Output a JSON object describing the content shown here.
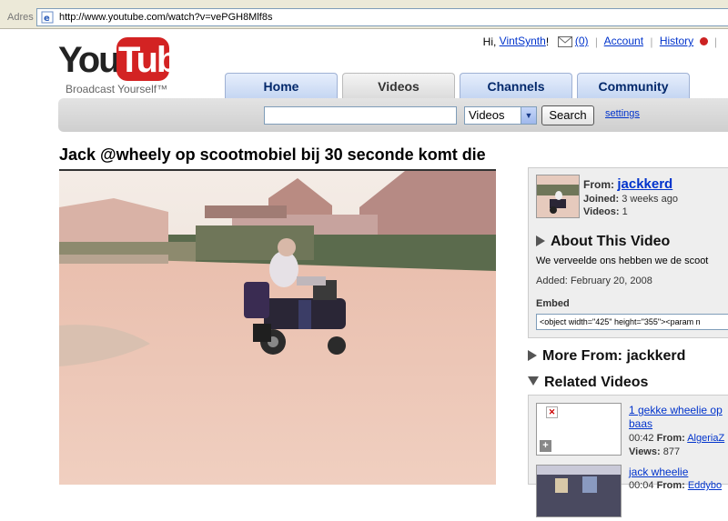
{
  "browser": {
    "address_label": "Adres",
    "url": "http://www.youtube.com/watch?v=vePGH8Mlf8s"
  },
  "header": {
    "logo_you": "You",
    "logo_tube": "Tube",
    "tagline": "Broadcast Yourself™",
    "greeting": "Hi,",
    "username": "VintSynth",
    "greeting_end": "!",
    "inbox_count": "(0)",
    "account_link": "Account",
    "history_link": "History"
  },
  "tabs": [
    {
      "label": "Home",
      "active": false
    },
    {
      "label": "Videos",
      "active": true
    },
    {
      "label": "Channels",
      "active": false
    },
    {
      "label": "Community",
      "active": false
    }
  ],
  "search": {
    "query": "",
    "category": "Videos",
    "button": "Search",
    "settings": "settings"
  },
  "video": {
    "title": "Jack @wheely op scootmobiel bij 30 seconde komt die"
  },
  "uploader": {
    "from_label": "From:",
    "name": "jackkerd",
    "joined_label": "Joined:",
    "joined": "3 weeks ago",
    "videos_label": "Videos:",
    "videos": "1"
  },
  "about": {
    "heading": "About This Video",
    "description": "We verveelde ons hebben we de scoot",
    "added_label": "Added:",
    "added": "February 20, 2008",
    "embed_label": "Embed",
    "embed_code": "<object width=\"425\" height=\"355\"><param n"
  },
  "more_from": {
    "heading": "More From: jackkerd"
  },
  "related": {
    "heading": "Related Videos",
    "items": [
      {
        "title_line1": "1 gekke wheelie op",
        "title_line2": "baas",
        "duration": "00:42",
        "from_label": "From:",
        "from": "AlgeriaZ",
        "views_label": "Views:",
        "views": "877"
      },
      {
        "title_line1": "jack wheelie",
        "duration": "00:04",
        "from_label": "From:",
        "from": "Eddybo"
      }
    ]
  },
  "colors": {
    "link": "#0033cc",
    "tab_blue": "#c5d6f2",
    "logo_red": "#d32323"
  }
}
